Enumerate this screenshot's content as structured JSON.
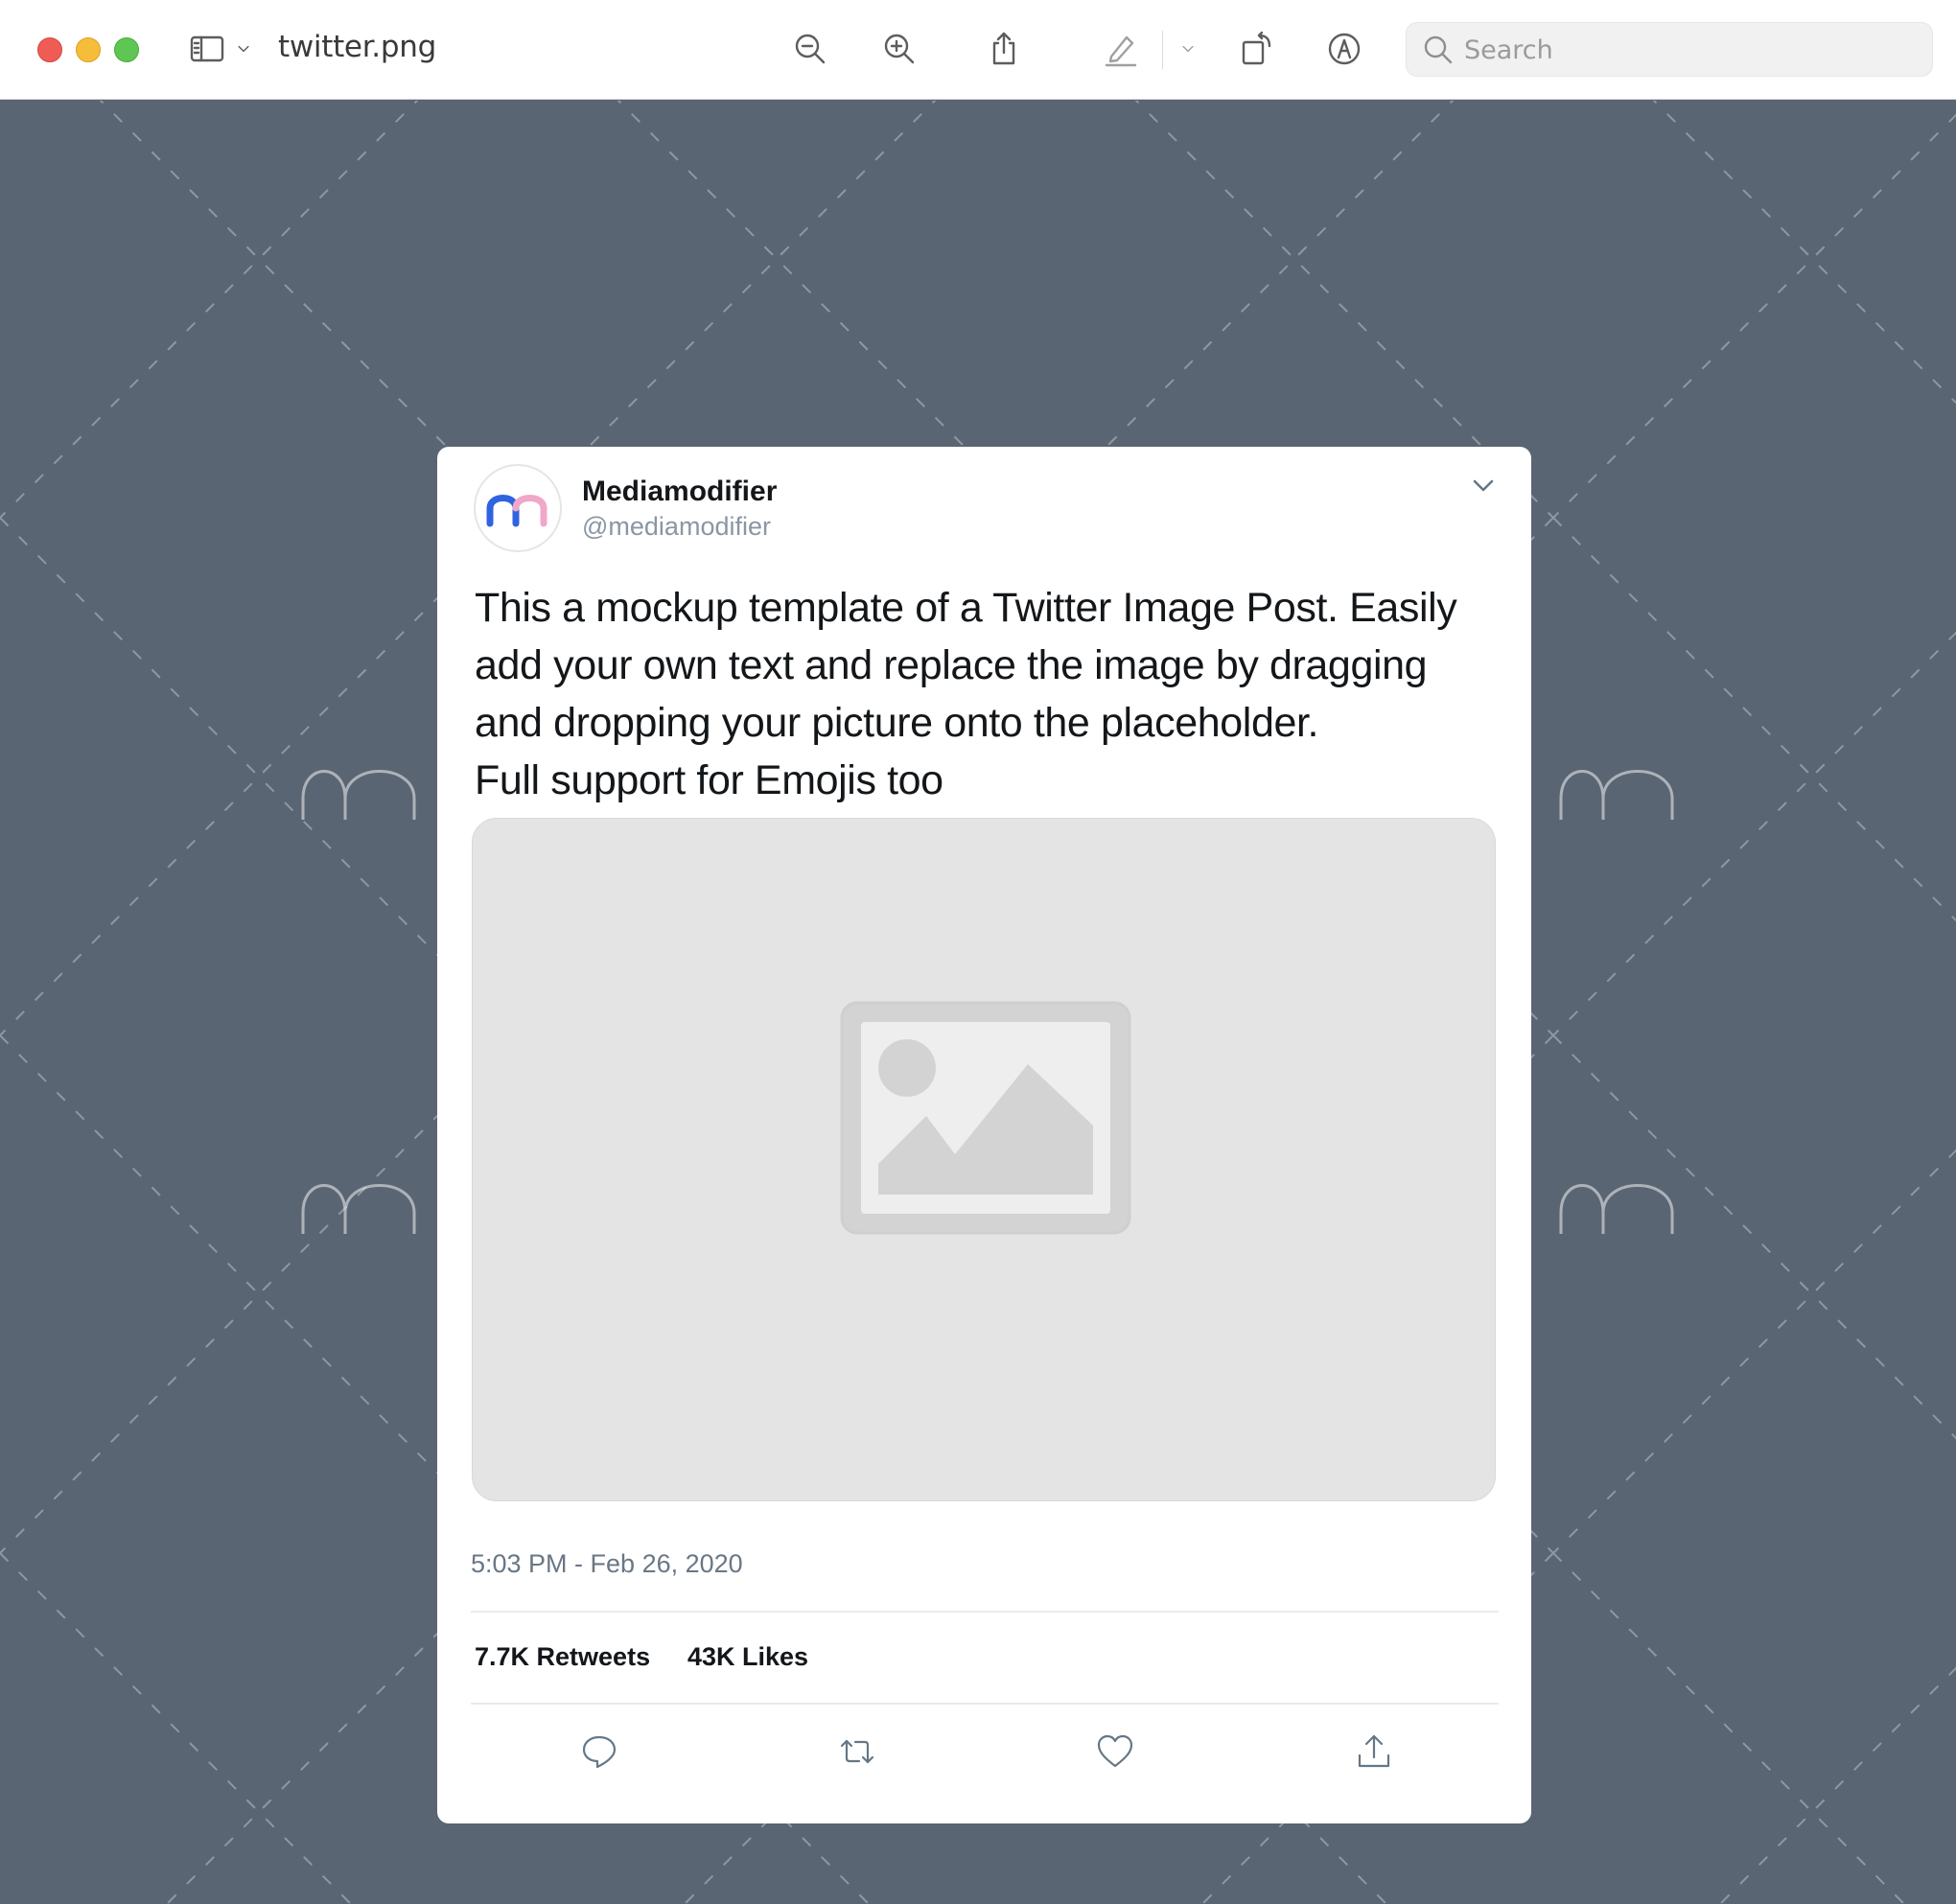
{
  "window": {
    "title": "twitter.png",
    "search": {
      "placeholder": "Search",
      "value": ""
    },
    "icons": [
      "sidebar-icon",
      "chevron-down-icon",
      "zoom-out-icon",
      "zoom-in-icon",
      "share-icon",
      "highlight-pen-icon",
      "rotate-icon",
      "markup-icon",
      "search-icon"
    ]
  },
  "tweet": {
    "author": {
      "name": "Mediamodifier",
      "handle": "@mediamodifier"
    },
    "text_lines": [
      "This a mockup template of a Twitter Image Post. Easily",
      "add your own text and replace the image by dragging",
      "and dropping your picture onto the placeholder.",
      "Full support for Emojis too"
    ],
    "timestamp": "5:03 PM - Feb 26, 2020",
    "stats": {
      "retweets": "7.7K Retweets",
      "likes": "43K Likes"
    },
    "actions": [
      "reply-icon",
      "retweet-icon",
      "like-icon",
      "share-icon"
    ]
  },
  "colors": {
    "canvas": "#5a6573",
    "logo_blue": "#2f63e0",
    "logo_pink": "#f1a7c8",
    "traffic_red": "#ee5c55",
    "traffic_yellow": "#f5bd3a",
    "traffic_green": "#5fc553"
  }
}
